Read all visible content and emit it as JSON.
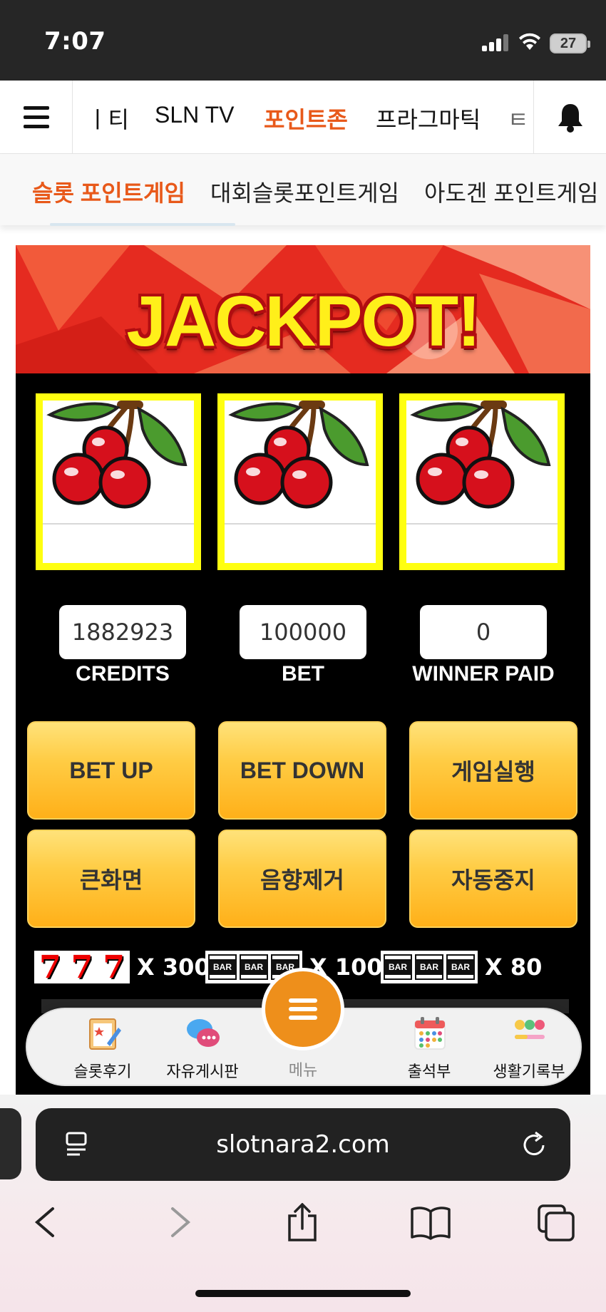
{
  "status_bar": {
    "time": "7:07",
    "battery": "27"
  },
  "nav": {
    "items": [
      "ㅣ티",
      "SLN TV",
      "포인트존",
      "프라그마틱",
      "ㅌ"
    ],
    "active": "포인트존"
  },
  "sub_tabs": {
    "items": [
      "슬롯 포인트게임",
      "대회슬롯포인트게임",
      "아도겐 포인트게임"
    ],
    "active": "슬롯 포인트게임"
  },
  "game": {
    "banner_title": "JACKPOT!",
    "reels": [
      "cherry",
      "cherry",
      "cherry"
    ],
    "credits": {
      "value": "1882923",
      "label": "CREDITS"
    },
    "bet": {
      "value": "100000",
      "label": "BET"
    },
    "winner_paid": {
      "value": "0",
      "label": "WINNER PAID"
    },
    "buttons": {
      "bet_up": "BET UP",
      "bet_down": "BET DOWN",
      "run": "게임실행",
      "fullscreen": "큰화면",
      "mute": "음향제거",
      "auto_stop": "자동중지"
    },
    "paytable": [
      {
        "symbol": "triple-seven",
        "payout": "X 300"
      },
      {
        "symbol": "triple-triple-bar",
        "payout": "X 100"
      },
      {
        "symbol": "triple-double-bar",
        "payout": "X 80"
      }
    ],
    "colors": {
      "reel_frame": "#ffff10",
      "button": "#ffc23a",
      "banner": "#e52b20"
    }
  },
  "bottom_nav": {
    "items": [
      {
        "label": "슬롯후기",
        "icon": "review-note-icon"
      },
      {
        "label": "자유게시판",
        "icon": "chat-bubbles-icon"
      },
      {
        "label": "메뉴",
        "icon": "menu-icon"
      },
      {
        "label": "출석부",
        "icon": "calendar-icon"
      },
      {
        "label": "생활기록부",
        "icon": "emoji-record-icon"
      }
    ],
    "accent": "#ee8f1b"
  },
  "browser": {
    "url": "slotnara2.com"
  }
}
